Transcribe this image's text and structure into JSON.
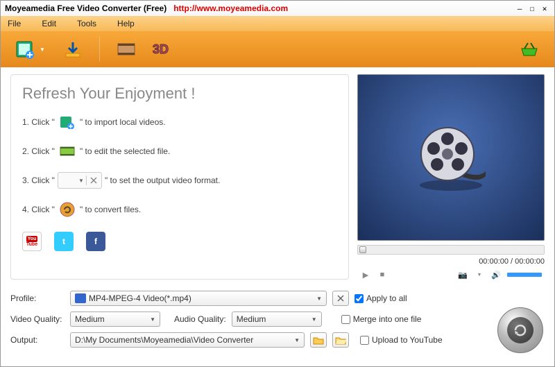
{
  "titlebar": {
    "app": "Moyeamedia Free Video Converter (Free)",
    "url": "http://www.moyeamedia.com"
  },
  "menu": {
    "file": "File",
    "edit": "Edit",
    "tools": "Tools",
    "help": "Help"
  },
  "welcome": {
    "heading": "Refresh Your Enjoyment !",
    "s1a": "1. Click \"",
    "s1b": "\" to import local videos.",
    "s2a": "2. Click \"",
    "s2b": "\" to edit the selected file.",
    "s3a": "3. Click \"",
    "s3b": "\" to set the output video format.",
    "s4a": "4. Click \"",
    "s4b": "\" to convert files."
  },
  "player": {
    "time": "00:00:00 / 00:00:00"
  },
  "form": {
    "profile_label": "Profile:",
    "profile_value": "MP4-MPEG-4 Video(*.mp4)",
    "apply_all": "Apply to all",
    "vq_label": "Video Quality:",
    "vq_value": "Medium",
    "aq_label": "Audio Quality:",
    "aq_value": "Medium",
    "merge": "Merge into one file",
    "output_label": "Output:",
    "output_value": "D:\\My Documents\\Moyeamedia\\Video Converter",
    "upload_yt": "Upload to YouTube"
  }
}
